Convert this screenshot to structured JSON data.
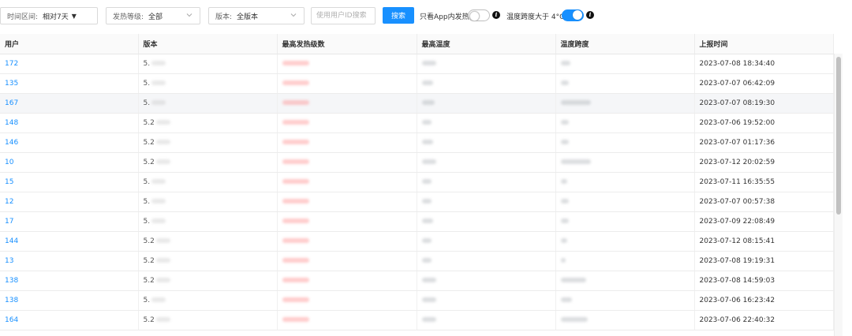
{
  "filters": {
    "time_range": {
      "label": "时间区间:",
      "value": "相对7天"
    },
    "heat_level": {
      "label": "发热等级:",
      "value": "全部"
    },
    "version": {
      "label": "版本:",
      "value": "全版本"
    },
    "search_placeholder": "使用用户ID搜索",
    "search_button": "搜索",
    "app_only_toggle": {
      "label": "只看App内发热",
      "checked": false
    },
    "temp_span_toggle": {
      "label": "温度跨度大于 4°C",
      "checked": true
    }
  },
  "colors": {
    "accent": "#1890ff",
    "link": "#1890ff"
  },
  "table": {
    "columns": [
      "用户",
      "版本",
      "最高发热级数",
      "最高温度",
      "温度跨度",
      "上报时间"
    ],
    "rows": [
      {
        "user": "172",
        "version": "5.",
        "time": "2023-07-08 18:34:40"
      },
      {
        "user": "135",
        "version": "5.",
        "time": "2023-07-07 06:42:09"
      },
      {
        "user": "167",
        "version": "5.",
        "time": "2023-07-07 08:19:30"
      },
      {
        "user": "148",
        "version": "5.2",
        "time": "2023-07-06 19:52:00"
      },
      {
        "user": "146",
        "version": "5.2",
        "time": "2023-07-07 01:17:36"
      },
      {
        "user": "10",
        "version": "5.2",
        "time": "2023-07-12 20:02:59"
      },
      {
        "user": "15",
        "version": "5.",
        "time": "2023-07-11 16:35:55"
      },
      {
        "user": "12",
        "version": "5.",
        "time": "2023-07-07 00:57:38"
      },
      {
        "user": "17",
        "version": "5.",
        "time": "2023-07-09 22:08:49"
      },
      {
        "user": "144",
        "version": "5.2",
        "time": "2023-07-12 08:15:41"
      },
      {
        "user": "13",
        "version": "5.2",
        "time": "2023-07-08 19:19:31"
      },
      {
        "user": "138",
        "version": "5.2",
        "time": "2023-07-08 14:59:03"
      },
      {
        "user": "138",
        "version": "5.",
        "time": "2023-07-06 16:23:42"
      },
      {
        "user": "164",
        "version": "5.2",
        "time": "2023-07-06 22:40:32"
      }
    ]
  }
}
